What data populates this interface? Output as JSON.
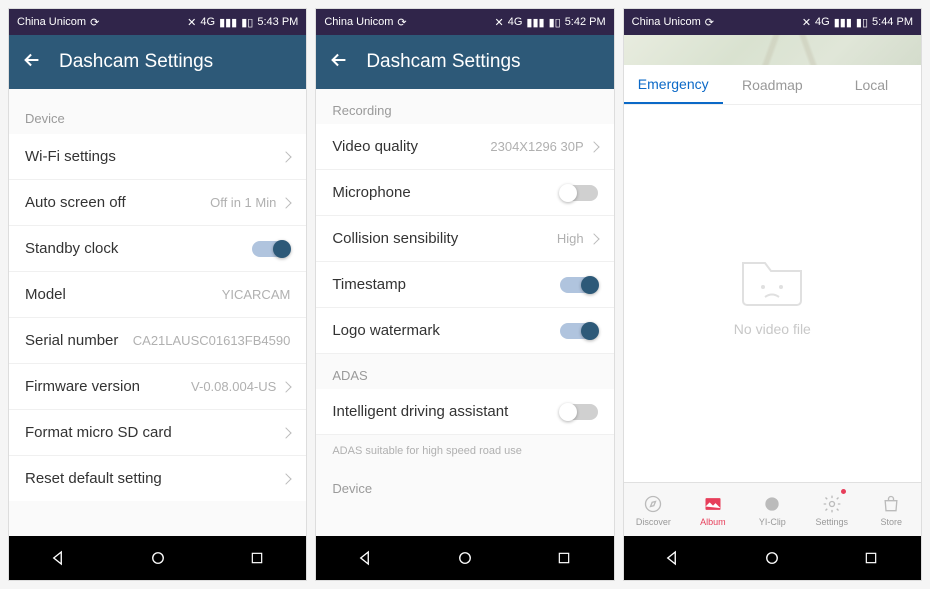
{
  "status": {
    "carrier": "China Unicom",
    "time1": "5:43 PM",
    "time2": "5:42 PM",
    "time3": "5:44 PM",
    "net": "4G"
  },
  "screen1": {
    "title": "Dashcam Settings",
    "section_device": "Device",
    "wifi": "Wi-Fi settings",
    "auto_off": "Auto screen off",
    "auto_off_val": "Off in 1 Min",
    "standby": "Standby clock",
    "standby_on": true,
    "model": "Model",
    "model_val": "YICARCAM",
    "serial": "Serial number",
    "serial_val": "CA21LAUSC01613FB4590",
    "fw": "Firmware version",
    "fw_val": "V-0.08.004-US",
    "format": "Format micro SD card",
    "reset": "Reset default setting"
  },
  "screen2": {
    "title": "Dashcam Settings",
    "section_recording": "Recording",
    "vq": "Video quality",
    "vq_val": "2304X1296 30P",
    "mic": "Microphone",
    "mic_on": false,
    "collision": "Collision sensibility",
    "collision_val": "High",
    "timestamp": "Timestamp",
    "timestamp_on": true,
    "logo": "Logo watermark",
    "logo_on": true,
    "section_adas": "ADAS",
    "ida": "Intelligent driving assistant",
    "ida_on": false,
    "adas_note": "ADAS suitable for high speed road use",
    "section_device": "Device"
  },
  "screen3": {
    "tabs": {
      "emergency": "Emergency",
      "roadmap": "Roadmap",
      "local": "Local"
    },
    "empty": "No video file",
    "nav": {
      "discover": "Discover",
      "album": "Album",
      "yiclip": "YI-Clip",
      "settings": "Settings",
      "store": "Store"
    }
  }
}
